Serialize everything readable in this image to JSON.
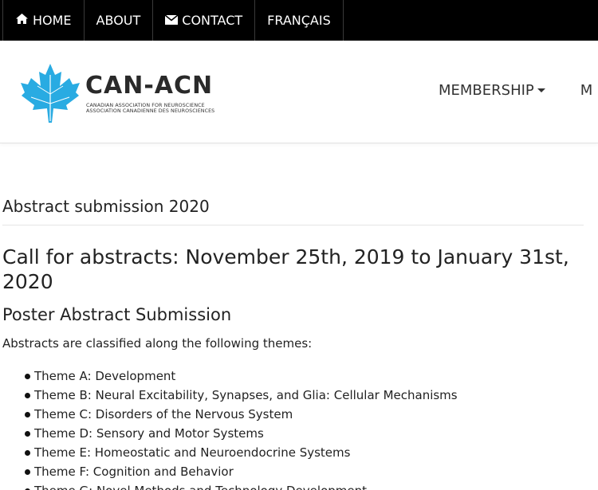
{
  "topnav": {
    "home": "HOME",
    "about": "ABOUT",
    "contact": "CONTACT",
    "french": "FRANÇAIS"
  },
  "logo": {
    "title": "CAN-ACN",
    "subtitle_en": "CANADIAN ASSOCIATION FOR NEUROSCIENCE",
    "subtitle_fr": "ASSOCIATION CANADIENNE DES NEUROSCIENCES",
    "leaf_color": "#29abe2"
  },
  "mainnav": {
    "membership": "MEMBERSHIP",
    "next": "M"
  },
  "content": {
    "page_title": "Abstract submission 2020",
    "heading": "Call for abstracts: November 25th, 2019 to January 31st, 2020",
    "subheading": "Poster Abstract Submission",
    "intro": "Abstracts are classified along the following themes:",
    "themes": [
      "Theme A: Development",
      "Theme B: Neural Excitability, Synapses, and Glia: Cellular Mechanisms",
      "Theme C: Disorders of the Nervous System",
      "Theme D: Sensory and Motor Systems",
      "Theme E: Homeostatic and Neuroendocrine Systems",
      "Theme F: Cognition and Behavior",
      "Theme G: Novel Methods and Technology Development"
    ]
  }
}
